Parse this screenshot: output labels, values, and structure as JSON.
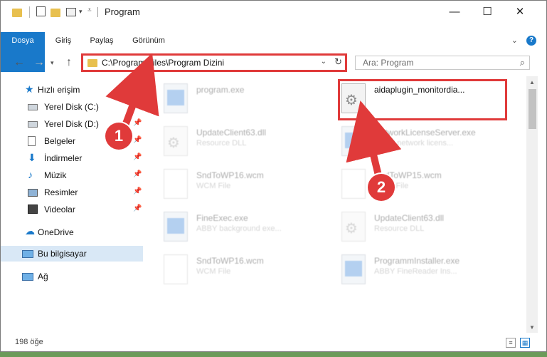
{
  "window": {
    "title": "Program",
    "minimize": "—",
    "maximize": "☐",
    "close": "✕"
  },
  "ribbon": {
    "tabs": [
      "Dosya",
      "Giriş",
      "Paylaş",
      "Görünüm"
    ],
    "expand": "⌄",
    "help": "?"
  },
  "address": {
    "path": "C:\\Program Files\\Program Dizini",
    "dropdown": "⌄",
    "refresh": "↻"
  },
  "search": {
    "placeholder": "Ara: Program",
    "icon": "search-icon"
  },
  "nav": {
    "quick_access": "Hızlı erişim",
    "items": [
      {
        "label": "Yerel Disk (C:)",
        "icon": "drive-icon"
      },
      {
        "label": "Yerel Disk (D:)",
        "icon": "drive-icon"
      },
      {
        "label": "Belgeler",
        "icon": "documents-icon"
      },
      {
        "label": "İndirmeler",
        "icon": "downloads-icon"
      },
      {
        "label": "Müzik",
        "icon": "music-icon"
      },
      {
        "label": "Resimler",
        "icon": "pictures-icon"
      },
      {
        "label": "Videolar",
        "icon": "videos-icon"
      }
    ],
    "onedrive": "OneDrive",
    "this_pc": "Bu bilgisayar",
    "network": "Ağ"
  },
  "files": [
    {
      "name": "program.exe",
      "sub": "",
      "type": "exe"
    },
    {
      "name": "aidaplugin_monitordia...",
      "sub": "",
      "type": "gear"
    },
    {
      "name": "UpdateClient63.dll",
      "sub": "Resource DLL",
      "type": "gear"
    },
    {
      "name": "NetworkLicenseServer.exe",
      "sub": "ABBY network licens...",
      "type": "exe"
    },
    {
      "name": "SndToWP16.wcm",
      "sub": "WCM File",
      "type": "doc"
    },
    {
      "name": "SndToWP15.wcm",
      "sub": "WCM File",
      "type": "doc"
    },
    {
      "name": "FineExec.exe",
      "sub": "ABBY background exe...",
      "type": "exe"
    },
    {
      "name": "UpdateClient63.dll",
      "sub": "Resource DLL",
      "type": "gear"
    },
    {
      "name": "SndToWP16.wcm",
      "sub": "WCM File",
      "type": "doc"
    },
    {
      "name": "ProgrammInstaller.exe",
      "sub": "ABBY FineReader Ins...",
      "type": "exe"
    }
  ],
  "status": {
    "count": "198 öğe"
  },
  "annotations": {
    "badge1": "1",
    "badge2": "2"
  },
  "colors": {
    "accent": "#1979ca",
    "highlight": "#e03a3a"
  }
}
